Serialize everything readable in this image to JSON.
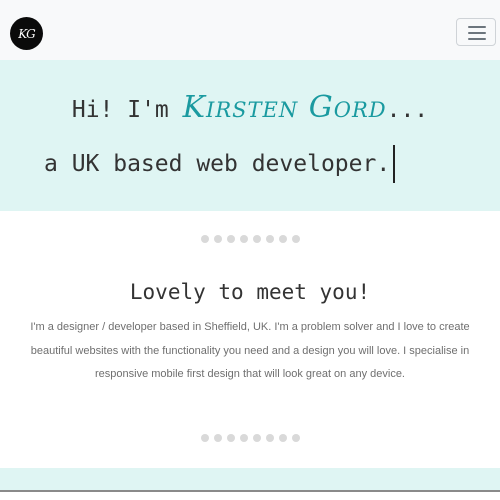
{
  "navbar": {
    "logo_text": "KG",
    "logo_icon": "kg-monogram-logo",
    "menu_icon": "hamburger-menu-icon"
  },
  "hero": {
    "greeting": "Hi! I'm ",
    "name": "Kirsten Gord",
    "ellipsis": "...",
    "tagline": "a UK based web developer.",
    "name_color": "#1a9aa0",
    "background_color": "#dff5f3"
  },
  "dividers": {
    "dot_count": 8
  },
  "about": {
    "title": "Lovely to meet you!",
    "body": "I'm a designer / developer based in Sheffield, UK. I'm a problem solver and I love to create beautiful websites with the functionality you need and a design you will love. I specialise in responsive mobile first design that will look great on any device."
  }
}
